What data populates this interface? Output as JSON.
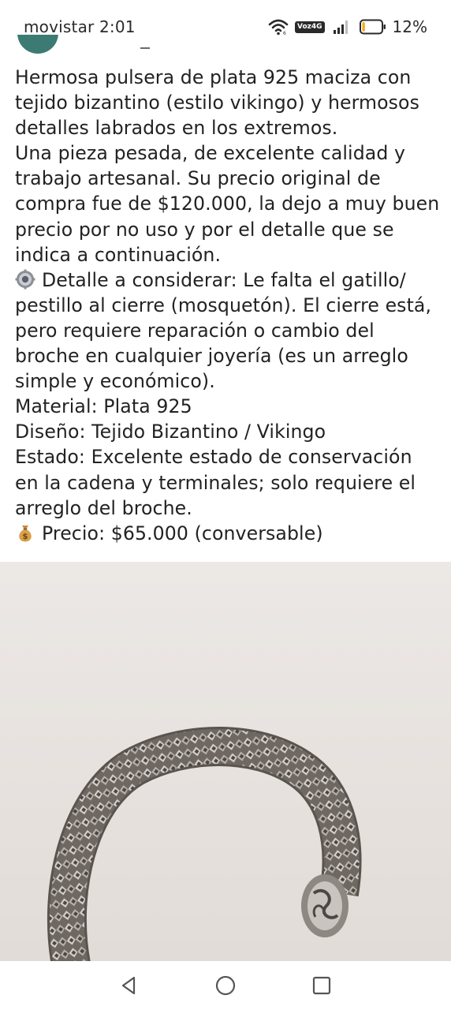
{
  "status_bar": {
    "carrier_time": "movistar 2:01",
    "network_badge": "Voz4G",
    "battery_percent": "12%",
    "battery_level": 0.12,
    "battery_color": "#f2a71b"
  },
  "description": {
    "lines": [
      "Hermosa pulsera de plata 925 maciza con",
      "tejido bizantino (estilo vikingo) y hermosos",
      "detalles labrados en los extremos.",
      "Una pieza pesada, de excelente calidad y",
      "trabajo artesanal. Su precio original de",
      "compra fue de $120.000, la dejo a muy buen",
      "precio por no uso y por el detalle que se",
      "indica a continuación.",
      "Detalle a considerar: Le falta el gatillo/",
      "pestillo al cierre (mosquetón). El cierre está,",
      "pero requiere reparación o cambio del",
      "broche en cualquier joyería (es un arreglo",
      "simple y económico).",
      "Material: Plata 925",
      "Diseño: Tejido Bizantino / Vikingo",
      "Estado: Excelente estado de conservación",
      "en la cadena y terminales; solo requiere el",
      "arreglo del broche.",
      "Precio: $65.000 (conversable)"
    ],
    "detail_icon": "gear-icon",
    "price_icon": "money-bag-icon"
  },
  "photo": {
    "subject": "silver-bracelet-photo",
    "background_color": "#e8e3e0"
  },
  "nav_bar": {
    "back_icon": "back-triangle-icon",
    "home_icon": "home-circle-icon",
    "recent_icon": "recent-square-icon"
  }
}
